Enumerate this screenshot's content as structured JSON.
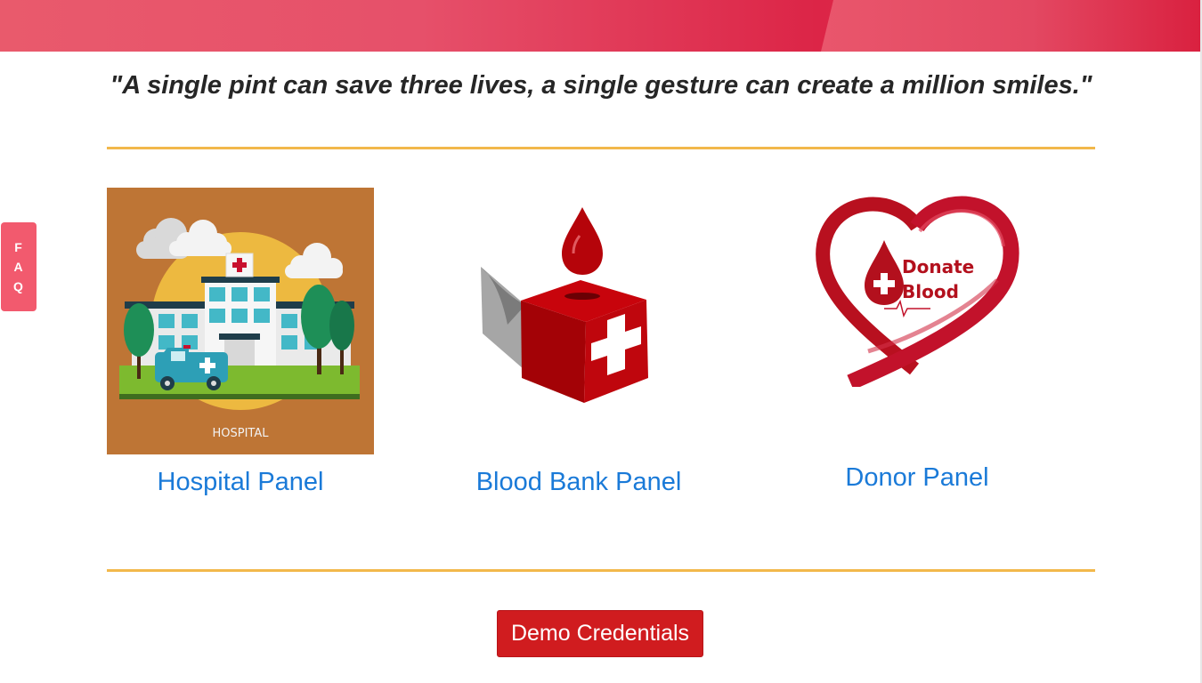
{
  "quote": "\"A single pint can save three lives, a single gesture can create a million smiles.\"",
  "faq_tab": {
    "letters": [
      "F",
      "A",
      "Q"
    ]
  },
  "panels": [
    {
      "label": "Hospital Panel",
      "image_caption": "HOSPITAL",
      "icon": "hospital-illustration"
    },
    {
      "label": "Blood Bank Panel",
      "icon": "blood-donation-box-icon"
    },
    {
      "label": "Donor Panel",
      "icon": "donate-blood-heart-logo",
      "logo_text": [
        "Donate",
        "Blood"
      ]
    }
  ],
  "demo_button": {
    "label": "Demo Credentials"
  },
  "colors": {
    "header_red": "#dc2547",
    "divider": "#f2b84b",
    "link_blue": "#1a7ad8",
    "button_red": "#d01c1f",
    "faq_pink": "#f25a6e"
  }
}
